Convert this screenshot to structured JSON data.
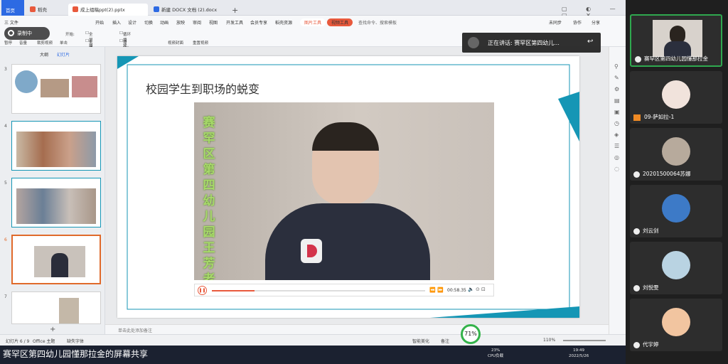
{
  "tabs": {
    "home": "首页",
    "wps": "稻壳",
    "active": "成上组稿ppt(2).pptx",
    "doc": "新建 DOCX 文档 (2).docx"
  },
  "menu": {
    "file": "三 文件",
    "items": [
      "开始",
      "插入",
      "设计",
      "切换",
      "动画",
      "放映",
      "审阅",
      "视图",
      "开发工具",
      "会员专享",
      "稻壳资源"
    ],
    "picture_tools": "图片工具",
    "video_tools": "视频工具",
    "search": "查找命令、搜索模板",
    "right": [
      "未同步",
      "协作",
      "分享"
    ]
  },
  "toolbar": {
    "pause": "暂停",
    "volume": "音量",
    "crop": "裁剪视频",
    "start_label": "开始:",
    "start_value": "单击",
    "fullscreen": "全屏播放",
    "hide_when_not_playing": "未播放时隐藏",
    "loop": "循环播放，直到停止",
    "rewind": "播放完返回开头",
    "cover": "视频封面",
    "reset": "重置视频"
  },
  "recording_label": "录制中",
  "left_panel": {
    "tab_outline": "大纲",
    "tab_slides": "幻灯片",
    "slide_numbers": [
      "3",
      "4",
      "5",
      "6",
      "7"
    ]
  },
  "slide": {
    "title": "校园学生到职场的蜕变",
    "vertical_text": "赛罕区第四幼儿园王芳老师"
  },
  "video": {
    "time": "00:58.35",
    "progress": 0.2
  },
  "notes_placeholder": "单击此处添加备注",
  "status": {
    "slide_counter": "幻灯片 6 / 9",
    "theme": "Office 主题",
    "font": "缺失字体",
    "smart": "智能美化",
    "notes": "备注",
    "zoom": "110%",
    "zoom_percent": "71%",
    "speed": "0.4K/s"
  },
  "taskbar": {
    "share_caption": "赛罕区第四幼儿园懂那拉金的屏幕共享",
    "cpu_value": "23%",
    "cpu_label": "CPU负载",
    "time": "19:49",
    "date": "2022/5/26"
  },
  "speaking": {
    "label": "正在讲话: 赛罕区第四幼儿..."
  },
  "participants": [
    {
      "name": "赛罕区第四幼儿园懂那拉金"
    },
    {
      "name": "09-萨如拉-1"
    },
    {
      "name": "20201500064苏娜"
    },
    {
      "name": "刘云剑"
    },
    {
      "name": "刘悦雯"
    },
    {
      "name": "代宇婷"
    }
  ],
  "colors": {
    "accent": "#2fa84f",
    "home_tab": "#2d6ae3",
    "picture_tools": "#e8593c",
    "video_tools": "#e8593c",
    "slide_teal": "#1596b5",
    "selected_thumb": "#e06a2b"
  }
}
